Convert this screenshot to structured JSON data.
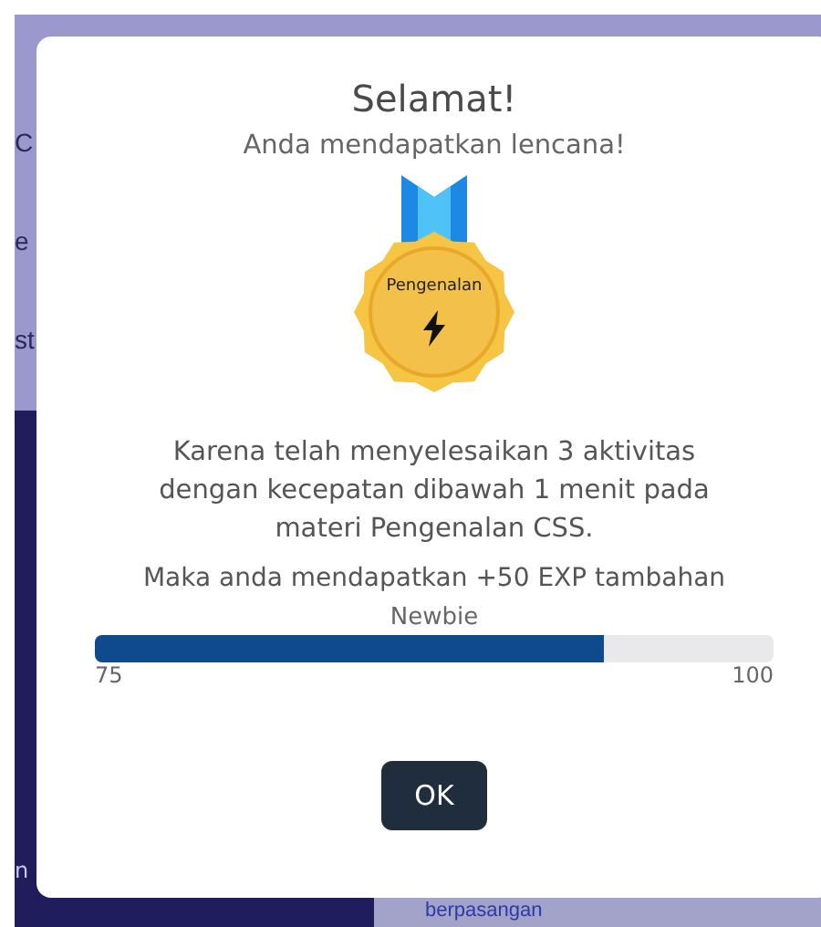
{
  "background": {
    "left_fragments": [
      "C",
      "e",
      "st"
    ],
    "bottom_left_fragment": "n",
    "bottom_right_fragment": "berpasangan"
  },
  "dialog": {
    "title": "Selamat!",
    "subtitle": "Anda mendapatkan lencana!",
    "badge": {
      "label": "Pengenalan"
    },
    "message": "Karena telah menyelesaikan 3 aktivitas dengan kecepatan dibawah 1 menit pada materi Pengenalan CSS.",
    "reward": "Maka anda mendapatkan +50 EXP tambahan",
    "progress": {
      "rank": "Newbie",
      "level": 0.75,
      "min_label": "75",
      "max_label": "100"
    },
    "ok_button": "OK"
  }
}
